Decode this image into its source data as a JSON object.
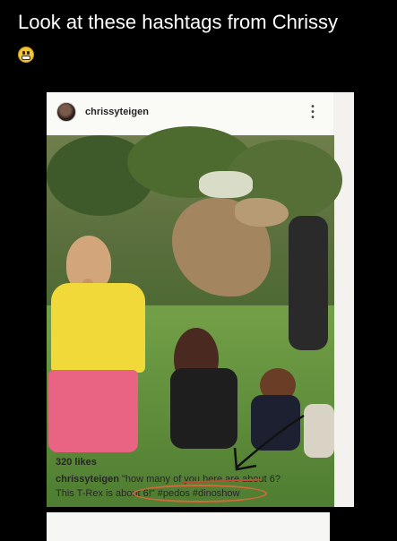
{
  "caption": {
    "text": "Look at these hashtags from Chrissy",
    "emoji": "grimacing-face-emoji"
  },
  "post": {
    "username": "chrissyteigen",
    "more_icon": "more-vertical-icon",
    "photo_alt": "photo",
    "actions": {
      "like_icon": "heart-icon",
      "comment_icon": "comment-icon",
      "share_icon": "share-icon",
      "save_icon": "bookmark-icon"
    },
    "likes": "320 likes",
    "caption_user": "chrissyteigen",
    "caption_line1": "\"how many of you here are about 6?",
    "caption_line2": "This T-Rex is about 6!\" #pedos #dinoshow"
  },
  "colors": {
    "background": "#000000",
    "card": "#f3f2ee",
    "annotation_red": "#c44a3a",
    "annotation_orange": "#d4673b"
  }
}
